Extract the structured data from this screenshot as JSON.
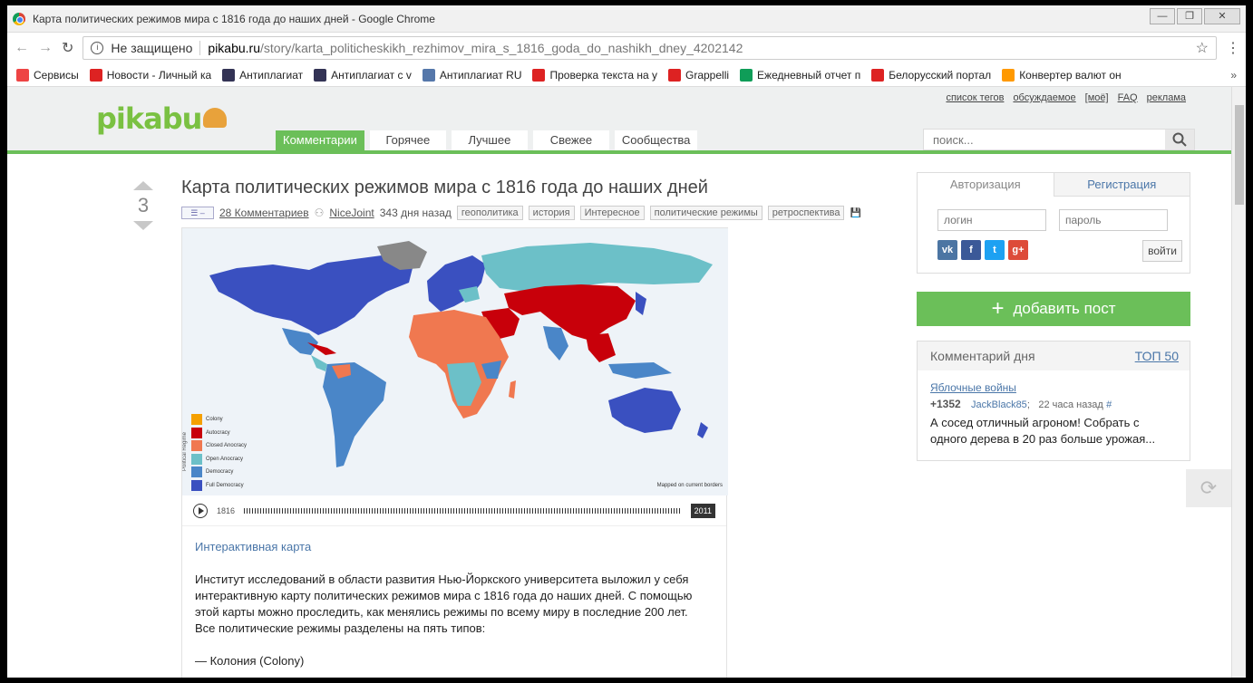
{
  "window": {
    "title": "Карта политических режимов мира с 1816 года до наших дней - Google Chrome",
    "controls": {
      "minimize": "—",
      "restore": "❐",
      "close": "✕"
    }
  },
  "address": {
    "security": "Не защищено",
    "domain": "pikabu.ru",
    "path": "/story/karta_politicheskikh_rezhimov_mira_s_1816_goda_do_nashikh_dney_4202142"
  },
  "bookmarks": [
    {
      "label": "Сервисы",
      "icon": "apps-grid-icon",
      "color": "#e44"
    },
    {
      "label": "Новости - Личный ка",
      "icon": "check-icon",
      "color": "#d22"
    },
    {
      "label": "Антиплагиат",
      "icon": "copyright-icon",
      "color": "#335"
    },
    {
      "label": "Антиплагиат с v",
      "icon": "copyright-icon",
      "color": "#335"
    },
    {
      "label": "Антиплагиат RU",
      "icon": "shield-icon",
      "color": "#57a"
    },
    {
      "label": "Проверка текста на у",
      "icon": "copyright-icon",
      "color": "#d22"
    },
    {
      "label": "Grappelli",
      "icon": "check-icon",
      "color": "#d22"
    },
    {
      "label": "Ежедневный отчет п",
      "icon": "sheet-icon",
      "color": "#0f9d58"
    },
    {
      "label": "Белорусский портал",
      "icon": "magnet-icon",
      "color": "#d22"
    },
    {
      "label": "Конвертер валют он",
      "icon": "triangle-icon",
      "color": "#f90"
    }
  ],
  "site": {
    "logo": "pikabu",
    "toplinks": [
      "список тегов",
      "обсуждаемое",
      "[моё]",
      "FAQ",
      "реклама"
    ],
    "tabs": [
      "Комментарии",
      "Горячее",
      "Лучшее",
      "Свежее",
      "Сообщества"
    ],
    "search_placeholder": "поиск..."
  },
  "post": {
    "rating": "3",
    "title": "Карта политических режимов мира с 1816 года до наших дней",
    "comments": "28 Комментариев",
    "author": "NiceJoint",
    "age": "343 дня назад",
    "tags": [
      "геополитика",
      "история",
      "Интересное",
      "политические режимы",
      "ретроспектива"
    ],
    "map": {
      "legend": [
        {
          "label": "Colony",
          "color": "#f5a000"
        },
        {
          "label": "Autocracy",
          "color": "#c8000a"
        },
        {
          "label": "Closed Anocracy",
          "color": "#f07850"
        },
        {
          "label": "Open Anocracy",
          "color": "#6cc0c8"
        },
        {
          "label": "Democracy",
          "color": "#4a86c8"
        },
        {
          "label": "Full Democracy",
          "color": "#3a50c0"
        }
      ],
      "legend_title": "Political Regime",
      "note": "Mapped on current borders",
      "year_start": "1816",
      "year_end": "2011"
    },
    "link_text": "Интерактивная карта",
    "paragraphs": [
      "Институт исследований в области развития Нью-Йоркского университета выложил у себя интерактивную карту политических режимов мира с 1816 года до наших дней. С помощью этой карты можно проследить, как менялись режимы по всему миру в последние 200 лет.",
      "Все политические режимы разделены на пять типов:"
    ],
    "list_first": "— Колония (Colony)"
  },
  "sidebar": {
    "auth_tab": "Авторизация",
    "register_tab": "Регистрация",
    "login_placeholder": "логин",
    "password_placeholder": "пароль",
    "login_button": "войти",
    "socials": [
      {
        "label": "vk",
        "color": "#4c75a3"
      },
      {
        "label": "f",
        "color": "#3b5998"
      },
      {
        "label": "t",
        "color": "#1da1f2"
      },
      {
        "label": "g+",
        "color": "#dd4b39"
      }
    ],
    "add_post": "добавить пост",
    "comment_day": {
      "heading": "Комментарий дня",
      "top_link": "ТОП 50",
      "title": "Яблочные войны",
      "rating": "+1352",
      "author": "JackBlack85",
      "time": "22 часа назад",
      "hash": "#",
      "text": "А сосед отличный агроном! Собрать с одного дерева в 20 раз больше урожая..."
    }
  }
}
